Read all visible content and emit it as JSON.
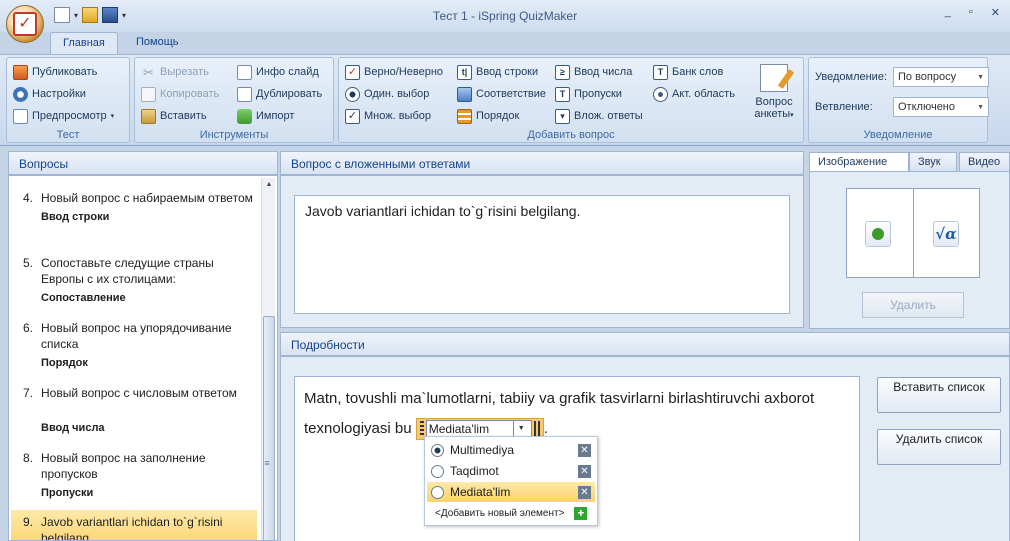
{
  "window": {
    "title": "Тест 1 - iSpring QuizMaker",
    "controls": [
      "_",
      "▫",
      "✕"
    ]
  },
  "ribbon_tabs": [
    "Главная",
    "Помощь"
  ],
  "ribbon": {
    "test": {
      "label": "Тест",
      "publish": "Публиковать",
      "settings": "Настройки",
      "preview": "Предпросмотр"
    },
    "tools": {
      "label": "Инструменты",
      "cut": "Вырезать",
      "copy": "Копировать",
      "paste": "Вставить",
      "info_slide": "Инфо слайд",
      "duplicate": "Дублировать",
      "import": "Импорт"
    },
    "add_question": {
      "label": "Добавить вопрос",
      "true_false": "Верно/Неверно",
      "single_choice": "Один. выбор",
      "multi_choice": "Множ. выбор",
      "type_in": "Ввод строки",
      "matching": "Соответствие",
      "sequence": "Порядок",
      "numeric": "Ввод числа",
      "fill_blanks": "Пропуски",
      "select_from_lists": "Влож. ответы",
      "word_bank": "Банк слов",
      "hotspot": "Акт. область",
      "survey_line1": "Вопрос",
      "survey_line2": "анкеты"
    },
    "notification": {
      "label": "Уведомление",
      "feedback_label": "Уведомление:",
      "feedback_value": "По вопросу",
      "branching_label": "Ветвление:",
      "branching_value": "Отключено"
    }
  },
  "questions_panel": {
    "title": "Вопросы",
    "items": [
      {
        "num": "4.",
        "text": "Новый вопрос с набираемым ответом",
        "type": "Ввод строки"
      },
      {
        "num": "5.",
        "text": "Сопоставьте следущие страны Европы с их столицами:",
        "type": "Сопоставление"
      },
      {
        "num": "6.",
        "text": "Новый вопрос на упорядочивание списка",
        "type": "Порядок"
      },
      {
        "num": "7.",
        "text": "Новый вопрос с числовым ответом",
        "type": "Ввод числа"
      },
      {
        "num": "8.",
        "text": "Новый вопрос на заполнение пропусков",
        "type": "Пропуски"
      },
      {
        "num": "9.",
        "text": "Javob variantlari ichidan to`g`risini belgilang"
      }
    ]
  },
  "question_panel": {
    "title": "Вопрос с вложенными ответами",
    "text": "Javob variantlari ichidan to`g`risini belgilang."
  },
  "details_panel": {
    "title": "Подробности",
    "text_before": "Matn, tovushli ma`lumotlarni, tabiiy va grafik tasvirlarni birlashtiruvchi axborot texnologiyasi bu",
    "text_after": ".",
    "field_value": "Mediata'lim",
    "options": [
      {
        "label": "Multimediya",
        "checked": true
      },
      {
        "label": "Taqdimot",
        "checked": false
      },
      {
        "label": "Mediata'lim",
        "checked": false
      }
    ],
    "add_item": "<Добавить новый элемент>",
    "insert_list": "Вставить список",
    "delete_list": "Удалить список"
  },
  "media": {
    "tabs": [
      "Изображение",
      "Звук",
      "Видео"
    ],
    "delete": "Удалить"
  },
  "icons": {
    "publish": "publish-icon",
    "settings": "gear-icon",
    "preview": "preview-icon",
    "cut": "scissors-icon",
    "copy": "copy-icon",
    "paste": "paste-icon",
    "image": "image-icon",
    "formula": "formula-icon"
  }
}
